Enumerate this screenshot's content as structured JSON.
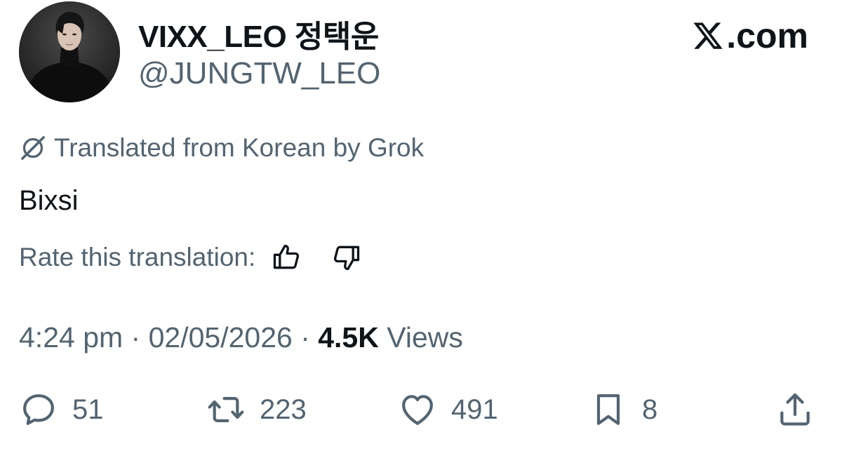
{
  "author": {
    "display_name": "VIXX_LEO 정택운",
    "handle": "@JUNGTW_LEO",
    "avatar_icon": "profile-photo"
  },
  "brand": {
    "label": ".com",
    "icon": "x-logo-icon"
  },
  "translation": {
    "notice": "Translated from Korean by Grok",
    "icon": "grok-icon"
  },
  "tweet": {
    "text": "Bixsi"
  },
  "rating": {
    "label": "Rate this translation:",
    "up_icon": "thumbs-up-icon",
    "down_icon": "thumbs-down-icon"
  },
  "meta": {
    "time": "4:24 pm",
    "separator": " · ",
    "date": "02/05/2026",
    "views_count": "4.5K",
    "views_label": " Views"
  },
  "actions": {
    "replies": "51",
    "reposts": "223",
    "likes": "491",
    "bookmarks": "8"
  },
  "colors": {
    "text_primary": "#0f1419",
    "text_secondary": "#536471",
    "background": "#ffffff"
  }
}
